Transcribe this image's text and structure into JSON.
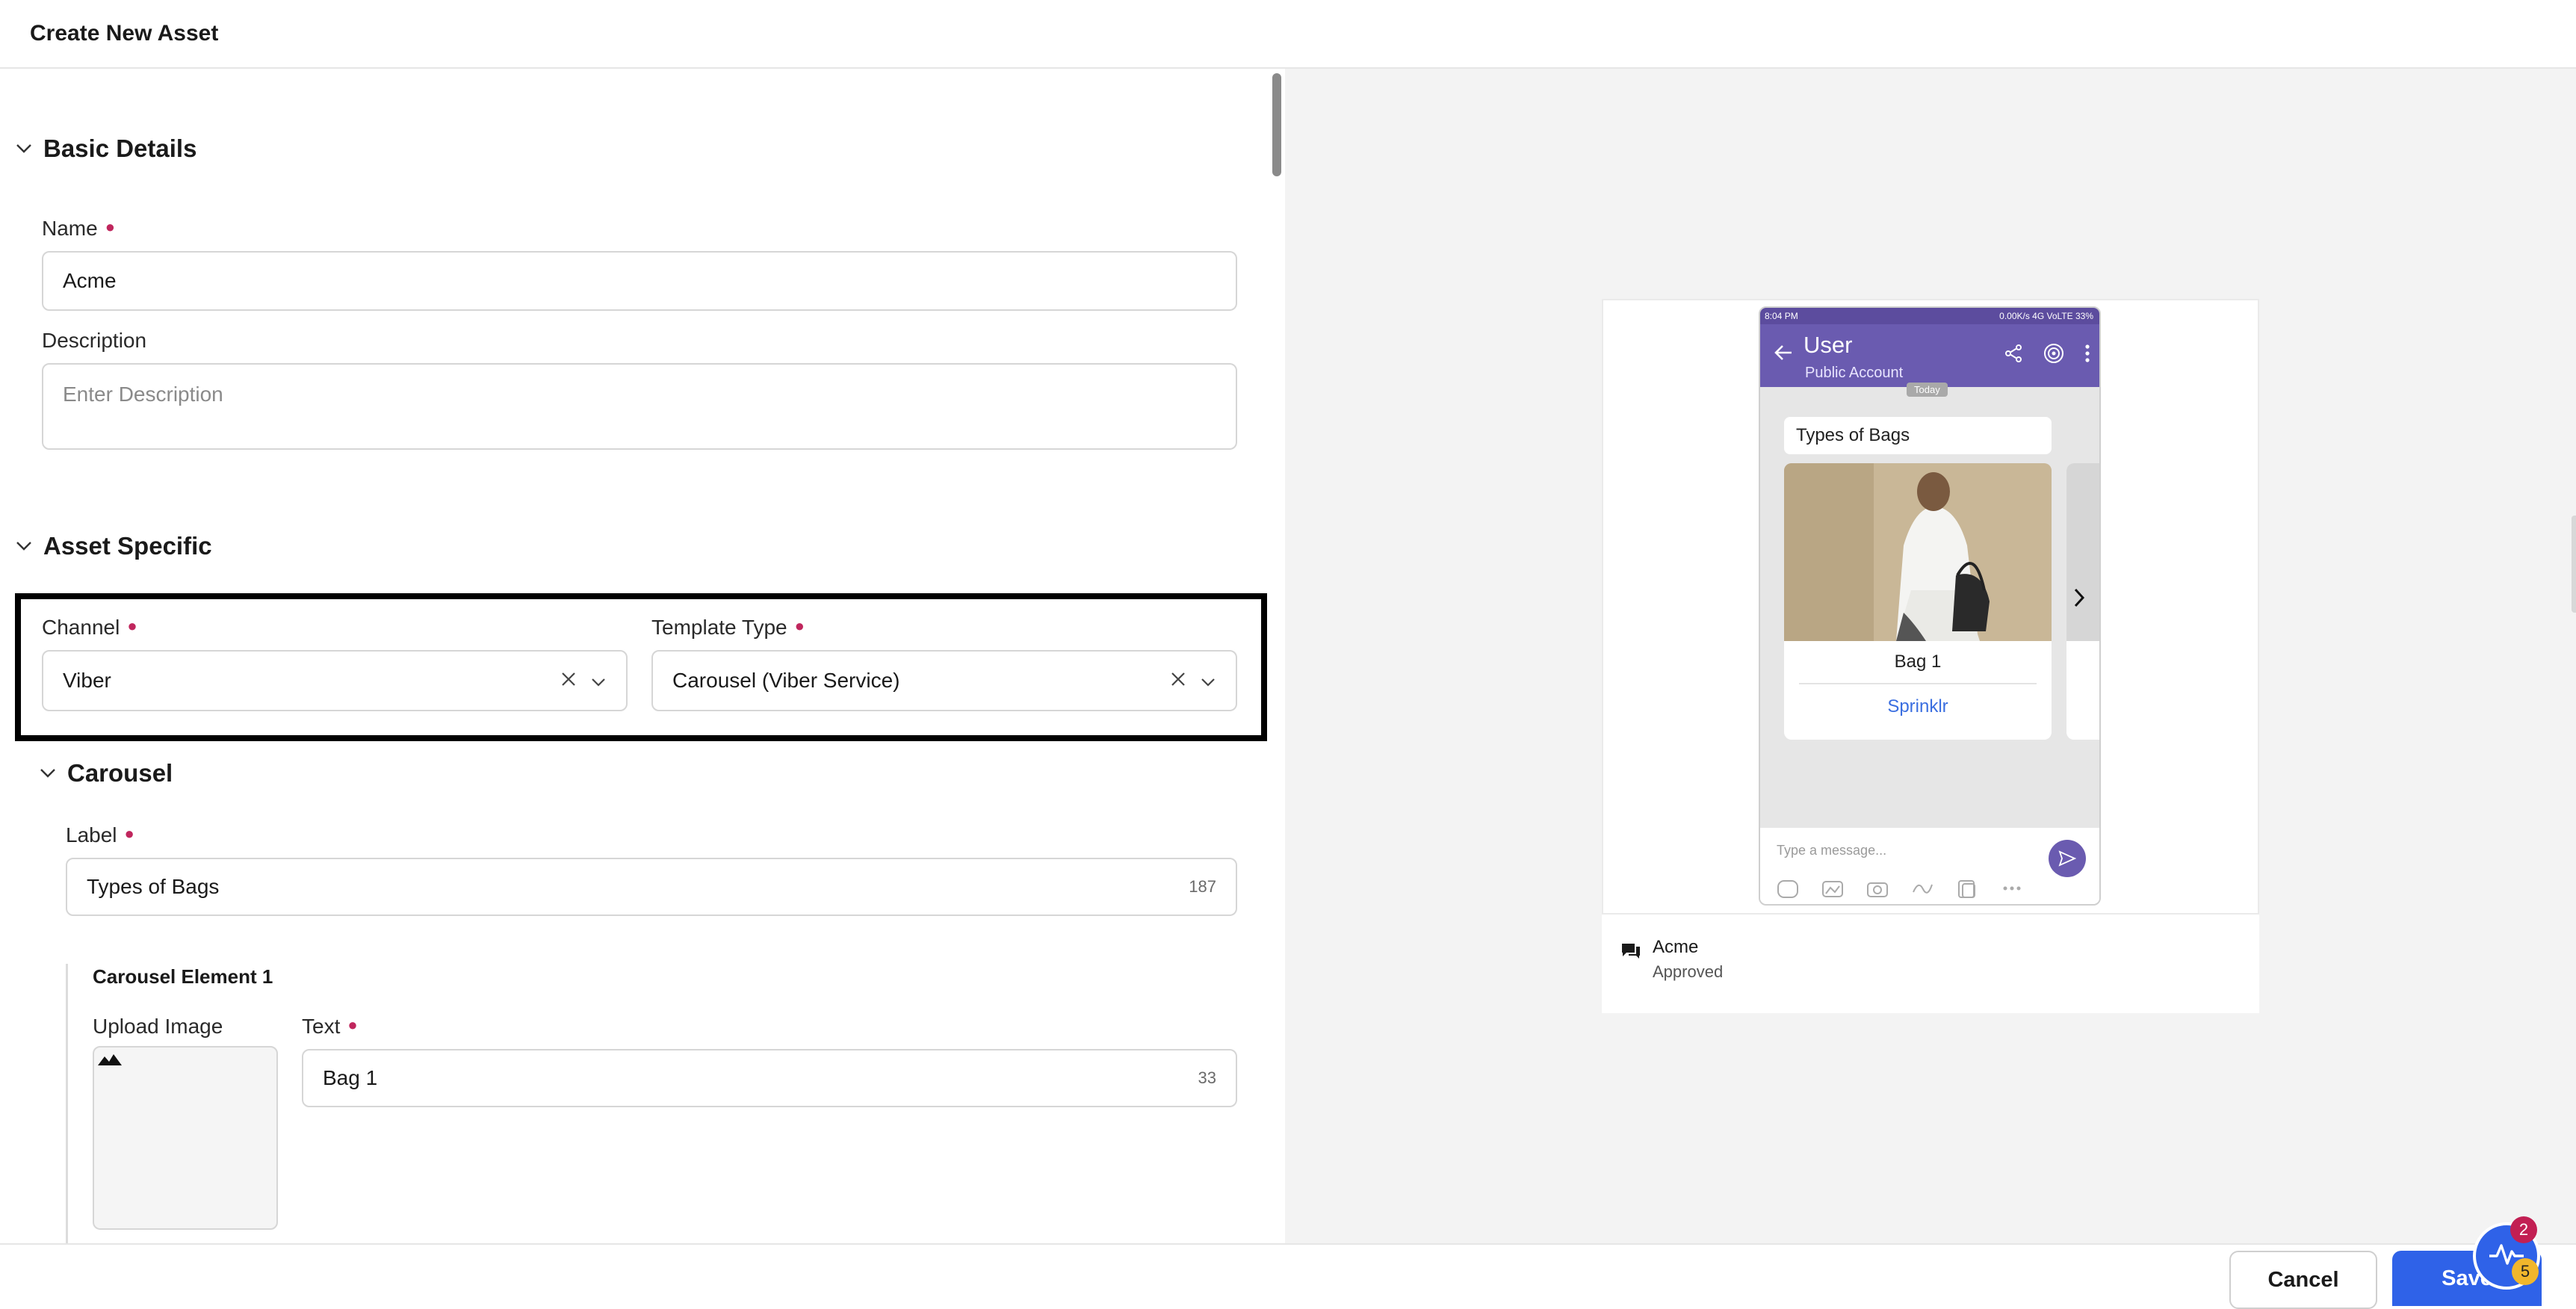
{
  "header": {
    "title": "Create New Asset"
  },
  "basic_details": {
    "title": "Basic Details",
    "name": {
      "label": "Name",
      "value": "Acme"
    },
    "description": {
      "label": "Description",
      "placeholder": "Enter Description"
    }
  },
  "asset_specific": {
    "title": "Asset Specific",
    "channel": {
      "label": "Channel",
      "value": "Viber"
    },
    "template_type": {
      "label": "Template Type",
      "value": "Carousel (Viber Service)"
    }
  },
  "carousel": {
    "title": "Carousel",
    "label": {
      "label": "Label",
      "value": "Types of Bags",
      "counter": "187"
    },
    "element1": {
      "title": "Carousel Element 1",
      "upload_label": "Upload Image",
      "text": {
        "label": "Text",
        "value": "Bag 1",
        "counter": "33"
      }
    }
  },
  "preview": {
    "statusbar_left": "8:04 PM",
    "statusbar_right": "0.00K/s  4G VoLTE  33%",
    "user_name": "User",
    "user_sub": "Public Account",
    "today": "Today",
    "label_bubble": "Types of Bags",
    "card_title": "Bag 1",
    "card_button": "Sprinklr",
    "composer_placeholder": "Type a message...",
    "asset_name": "Acme",
    "asset_status": "Approved"
  },
  "footer": {
    "cancel": "Cancel",
    "save": "Save"
  },
  "activity": {
    "badge_top": "2",
    "badge_bottom": "5"
  },
  "colors": {
    "accent": "#2f62e8",
    "viber": "#6a5bb0",
    "required": "#c0265d"
  }
}
